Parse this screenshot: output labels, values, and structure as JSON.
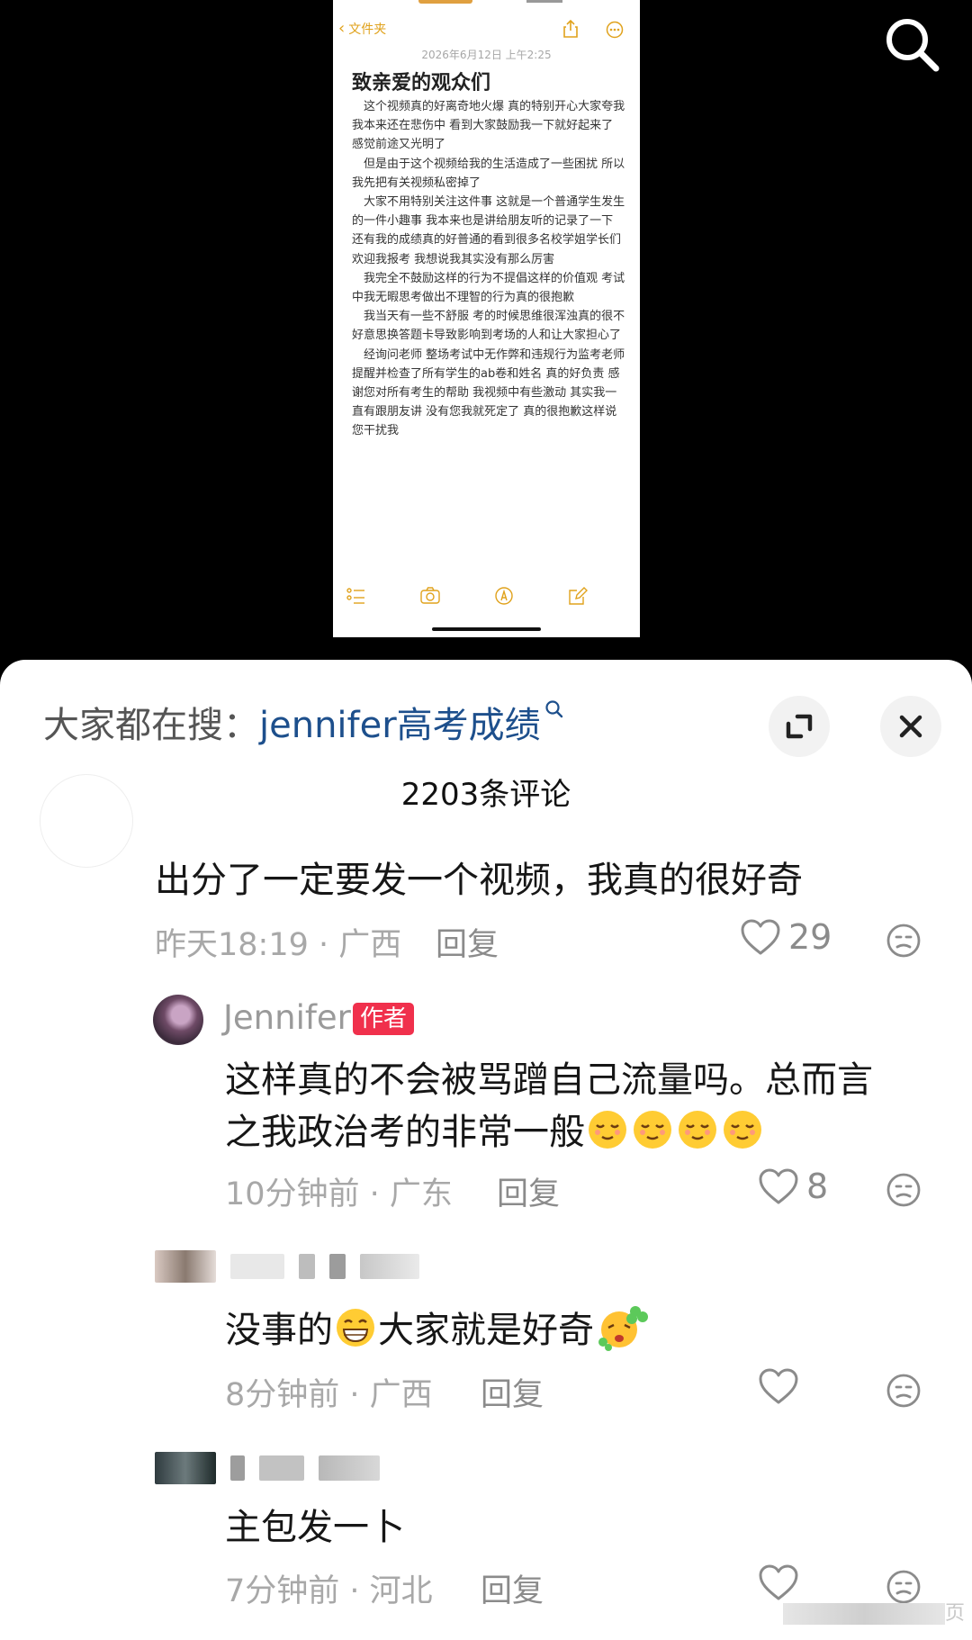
{
  "notes": {
    "back_label": "文件夹",
    "date": "2026年6月12日 上午2:25",
    "title": "致亲爱的观众们",
    "paragraphs": [
      "这个视频真的好离奇地火爆 真的特别开心大家夸我 我本来还在悲伤中 看到大家鼓励我一下就好起来了 感觉前途又光明了",
      "但是由于这个视频给我的生活造成了一些困扰 所以我先把有关视频私密掉了",
      "大家不用特别关注这件事 这就是一个普通学生发生的一件小趣事 我本来也是讲给朋友听的记录了一下 还有我的成绩真的好普通的看到很多名校学姐学长们欢迎我报考 我想说我其实没有那么厉害",
      "我完全不鼓励这样的行为不提倡这样的价值观 考试中我无暇思考做出不理智的行为真的很抱歉",
      "我当天有一些不舒服 考的时候思维很浑浊真的很不好意思换答题卡导致影响到考场的人和让大家担心了",
      "经询问老师 整场考试中无作弊和违规行为监考老师提醒并检查了所有学生的ab卷和姓名 真的好负责 感谢您对所有考生的帮助 我视频中有些激动 其实我一直有跟朋友讲 没有您我就死定了 真的很抱歉这样说您干扰我"
    ]
  },
  "sheet": {
    "hot_search_prefix": "大家都在搜：",
    "hot_search_term": "jennifer高考成绩",
    "comment_count": "2203条评论"
  },
  "comments": [
    {
      "text": "出分了一定要发一个视频，我真的很好奇",
      "meta": "昨天18:19 · 广西",
      "reply": "回复",
      "likes": "29"
    },
    {
      "author": "Jennifer",
      "badge": "作者",
      "text_line1": "这样真的不会被骂蹭自己流量吗。总而言",
      "text_line2": "之我政治考的非常一般",
      "meta": "10分钟前 · 广东",
      "reply": "回复",
      "likes": "8"
    },
    {
      "text_a": "没事的",
      "text_b": "大家就是好奇",
      "meta": "8分钟前 · 广西",
      "reply": "回复",
      "likes": ""
    },
    {
      "text": "主包发一卜",
      "meta": "7分钟前 · 河北",
      "reply": "回复",
      "likes": ""
    }
  ],
  "watermark": "页",
  "colors": {
    "accent": "#f0304c",
    "link": "#1d4f8c",
    "notes_tint": "#e0a21c"
  },
  "icons": [
    "search-icon",
    "expand-icon",
    "close-icon",
    "heart-icon",
    "dislike-icon",
    "share-icon",
    "more-icon"
  ]
}
